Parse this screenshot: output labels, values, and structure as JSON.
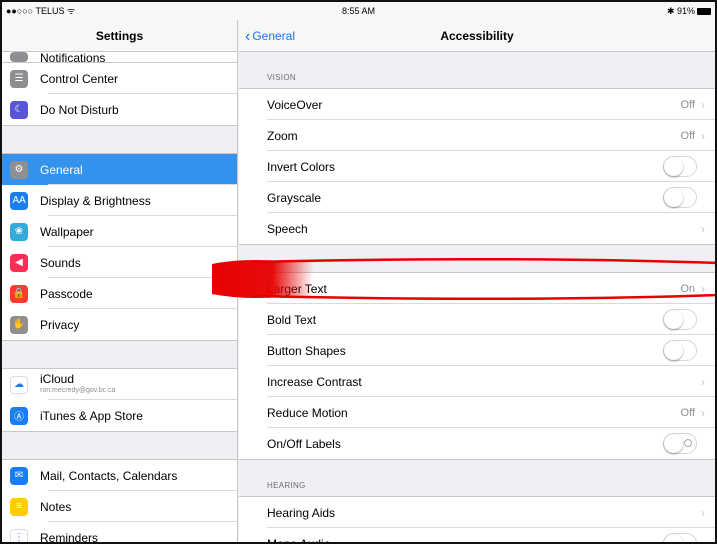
{
  "status": {
    "carrier": "●●○○○ TELUS ᯤ",
    "time": "8:55 AM",
    "battery": "✱ 91%"
  },
  "sidebar": {
    "title": "Settings",
    "clipped_item": "Notifications",
    "groups": [
      [
        {
          "label": "Control Center",
          "icon": "control-center-icon",
          "color": "#8e8e93",
          "glyph": "☰"
        },
        {
          "label": "Do Not Disturb",
          "icon": "moon-icon",
          "color": "#5856d6",
          "glyph": "☾"
        }
      ],
      [
        {
          "label": "General",
          "icon": "gear-icon",
          "color": "#8e8e93",
          "glyph": "⚙",
          "active": true
        },
        {
          "label": "Display & Brightness",
          "icon": "display-brightness-icon",
          "color": "#1a7ef2",
          "glyph": "AA"
        },
        {
          "label": "Wallpaper",
          "icon": "wallpaper-icon",
          "color": "#33aadc",
          "glyph": "❀"
        },
        {
          "label": "Sounds",
          "icon": "speaker-icon",
          "color": "#ff2d55",
          "glyph": "◀"
        },
        {
          "label": "Passcode",
          "icon": "lock-icon",
          "color": "#ff3b30",
          "glyph": "🔒"
        },
        {
          "label": "Privacy",
          "icon": "hand-icon",
          "color": "#8e8e93",
          "glyph": "✋"
        }
      ],
      [
        {
          "label": "iCloud",
          "sub": "ron.mecredy@gov.bc.ca",
          "icon": "cloud-icon",
          "color": "#ffffff",
          "glyph": "☁"
        },
        {
          "label": "iTunes & App Store",
          "icon": "app-store-icon",
          "color": "#1a7ef2",
          "glyph": "Ⓐ"
        }
      ],
      [
        {
          "label": "Mail, Contacts, Calendars",
          "icon": "mail-icon",
          "color": "#1a7ef2",
          "glyph": "✉"
        },
        {
          "label": "Notes",
          "icon": "notes-icon",
          "color": "#ffcc00",
          "glyph": "≡"
        },
        {
          "label": "Reminders",
          "icon": "reminders-icon",
          "color": "#ffffff",
          "glyph": "⋮"
        }
      ]
    ]
  },
  "detail": {
    "back_label": "General",
    "title": "Accessibility",
    "sections": [
      {
        "label": "VISION",
        "rows": [
          {
            "label": "VoiceOver",
            "value": "Off",
            "type": "nav"
          },
          {
            "label": "Zoom",
            "value": "Off",
            "type": "nav"
          },
          {
            "label": "Invert Colors",
            "type": "toggle"
          },
          {
            "label": "Grayscale",
            "type": "toggle"
          },
          {
            "label": "Speech",
            "type": "nav"
          }
        ]
      },
      {
        "label": "",
        "rows": [
          {
            "label": "Larger Text",
            "value": "On",
            "type": "nav"
          },
          {
            "label": "Bold Text",
            "type": "toggle"
          },
          {
            "label": "Button Shapes",
            "type": "toggle"
          },
          {
            "label": "Increase Contrast",
            "type": "nav"
          },
          {
            "label": "Reduce Motion",
            "value": "Off",
            "type": "nav"
          },
          {
            "label": "On/Off Labels",
            "type": "toggle-label"
          }
        ]
      },
      {
        "label": "HEARING",
        "rows": [
          {
            "label": "Hearing Aids",
            "type": "nav"
          },
          {
            "label": "Mono Audio",
            "type": "toggle"
          }
        ]
      }
    ]
  },
  "colors": {
    "accent": "#3393ec",
    "link": "#1a74f4",
    "highlight_marker": "#e60000"
  }
}
